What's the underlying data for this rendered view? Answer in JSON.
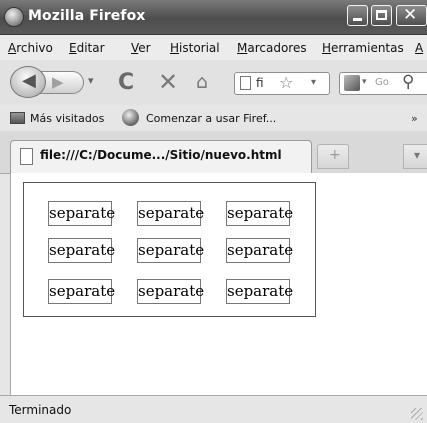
{
  "window": {
    "title": "Mozilla Firefox"
  },
  "menubar": [
    "Archivo",
    "Editar",
    "Ver",
    "Historial",
    "Marcadores",
    "Herramientas",
    "A"
  ],
  "nav": {
    "url_text": "fi",
    "search_placeholder": "Go"
  },
  "bookmarks": [
    {
      "label": "Más visitados",
      "icon": "folder-icon"
    },
    {
      "label": "Comenzar a usar Firef...",
      "icon": "firefox-icon"
    }
  ],
  "bookmarks_more": "»",
  "tab": {
    "label": "file:///C:/Docume.../Sitio/nuevo.html"
  },
  "content": {
    "grid": [
      [
        "separate",
        "separate",
        "separate"
      ],
      [
        "separate",
        "separate",
        "separate"
      ],
      [
        "separate",
        "separate",
        "separate"
      ]
    ]
  },
  "statusbar": {
    "text": "Terminado"
  }
}
